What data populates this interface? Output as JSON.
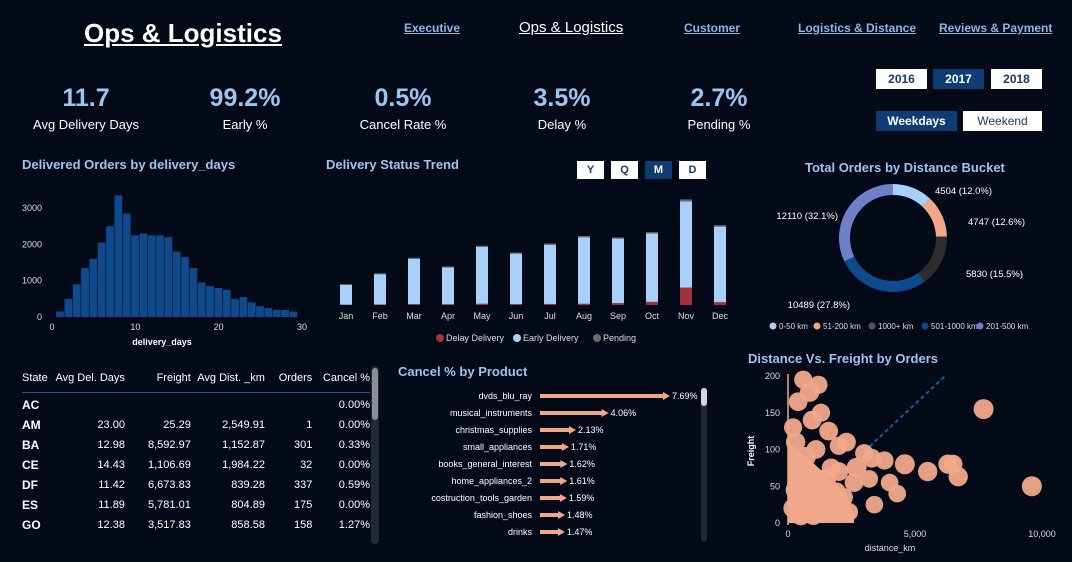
{
  "header": {
    "title": "Ops & Logistics"
  },
  "nav": [
    {
      "label": "Executive",
      "current": false
    },
    {
      "label": "Ops & Logistics",
      "current": true
    },
    {
      "label": "Customer",
      "current": false
    },
    {
      "label": "Logistics & Distance",
      "current": false
    },
    {
      "label": "Reviews & Payment",
      "current": false
    }
  ],
  "kpis": [
    {
      "value": "11.7",
      "label": "Avg Delivery Days"
    },
    {
      "value": "99.2%",
      "label": "Early %"
    },
    {
      "value": "0.5%",
      "label": "Cancel Rate %"
    },
    {
      "value": "3.5%",
      "label": "Delay %"
    },
    {
      "value": "2.7%",
      "label": "Pending %"
    }
  ],
  "filters": {
    "years": [
      {
        "label": "2016",
        "selected": false
      },
      {
        "label": "2017",
        "selected": true
      },
      {
        "label": "2018",
        "selected": false
      }
    ],
    "daytype": [
      {
        "label": "Weekdays",
        "selected": true
      },
      {
        "label": "Weekend",
        "selected": false
      }
    ],
    "granularity": [
      {
        "label": "Y",
        "selected": false
      },
      {
        "label": "Q",
        "selected": false
      },
      {
        "label": "M",
        "selected": true
      },
      {
        "label": "D",
        "selected": false
      }
    ]
  },
  "colors": {
    "bg": "#040a17",
    "accent": "#9ec5f0",
    "bar_dark": "#0f4a8c",
    "early": "#a8d0fb",
    "delay": "#a3303a",
    "pending": "#6b6b6b",
    "salmon": "#f0a88a"
  },
  "chart_data": [
    {
      "id": "histogram",
      "type": "bar",
      "title": "Delivered Orders by delivery_days",
      "xlabel": "delivery_days",
      "ylabel": "",
      "xlim": [
        0,
        30
      ],
      "ylim": [
        0,
        3500
      ],
      "xticks": [
        0,
        10,
        20,
        30
      ],
      "yticks": [
        0,
        1000,
        2000,
        3000
      ],
      "bin_start": 0.5,
      "bin_width": 1,
      "values": [
        150,
        500,
        900,
        1350,
        1600,
        2050,
        2500,
        3350,
        2850,
        2250,
        2300,
        2250,
        2250,
        2200,
        1800,
        1650,
        1350,
        950,
        850,
        800,
        750,
        500,
        550,
        400,
        300,
        250,
        200,
        200,
        150
      ]
    },
    {
      "id": "delivery-trend",
      "type": "bar",
      "title": "Delivery Status Trend",
      "categories": [
        "Jan",
        "Feb",
        "Mar",
        "Apr",
        "May",
        "Jun",
        "Jul",
        "Aug",
        "Sep",
        "Oct",
        "Nov",
        "Dec"
      ],
      "series": [
        {
          "name": "Delay Delivery",
          "values": [
            10,
            15,
            25,
            20,
            35,
            25,
            30,
            35,
            55,
            90,
            500,
            80
          ]
        },
        {
          "name": "Early Delivery",
          "values": [
            570,
            870,
            1300,
            1060,
            1630,
            1450,
            1700,
            1910,
            1850,
            1960,
            2470,
            2170
          ]
        },
        {
          "name": "Pending",
          "values": [
            20,
            25,
            30,
            25,
            35,
            30,
            35,
            35,
            35,
            40,
            60,
            40
          ]
        }
      ],
      "ylim": [
        0,
        3300
      ],
      "legend": "bottom"
    },
    {
      "id": "distance-donut",
      "type": "pie",
      "title": "Total Orders by Distance Bucket",
      "slices": [
        {
          "name": "0-50 km",
          "value": 4504,
          "label": "4504 (12.0%)",
          "color": "#a8d0fb"
        },
        {
          "name": "51-200 km",
          "value": 4747,
          "label": "4747 (12.6%)",
          "color": "#f0a88a"
        },
        {
          "name": "1000+ km",
          "value": 5830,
          "label": "5830 (15.5%)",
          "color": "#2d2d2d"
        },
        {
          "name": "501-1000 km",
          "value": 10489,
          "label": "10489 (27.8%)",
          "color": "#0f4a8c"
        },
        {
          "name": "201-500 km",
          "value": 12110,
          "label": "12110 (32.1%)",
          "color": "#6f7fc9"
        }
      ],
      "legend": "bottom"
    },
    {
      "id": "cancel-by-product",
      "type": "bar",
      "title": "Cancel % by Product",
      "categories": [
        "dvds_blu_ray",
        "musical_instruments",
        "christmas_supplies",
        "small_appliances",
        "books_general_interest",
        "home_appliances_2",
        "costruction_tools_garden",
        "fashion_shoes",
        "drinks"
      ],
      "values": [
        7.69,
        4.06,
        2.13,
        1.71,
        1.62,
        1.61,
        1.59,
        1.48,
        1.47
      ],
      "value_labels": [
        "7.69%",
        "4.06%",
        "2.13%",
        "1.71%",
        "1.62%",
        "1.61%",
        "1.59%",
        "1.48%",
        "1.47%"
      ]
    },
    {
      "id": "distance-freight",
      "type": "scatter",
      "title": "Distance Vs. Freight by Orders",
      "xlabel": "distance_km",
      "ylabel": "Freight",
      "xlim": [
        0,
        10000
      ],
      "ylim": [
        0,
        200
      ],
      "xticks": [
        0,
        5000,
        10000
      ],
      "xtick_labels": [
        "0",
        "5,000",
        "10,000"
      ],
      "yticks": [
        0,
        50,
        100,
        150,
        200
      ],
      "points": [
        [
          9600,
          50,
          1.0
        ],
        [
          7700,
          155,
          1.0
        ],
        [
          6700,
          63,
          0.9
        ],
        [
          6300,
          80,
          0.9
        ],
        [
          6500,
          80,
          0.8
        ],
        [
          5500,
          70,
          0.9
        ],
        [
          4600,
          80,
          1.0
        ],
        [
          3800,
          85,
          0.7
        ],
        [
          3300,
          88,
          0.8
        ],
        [
          3000,
          95,
          0.7
        ],
        [
          2700,
          75,
          1.0
        ],
        [
          2300,
          110,
          0.8
        ],
        [
          2000,
          105,
          0.7
        ],
        [
          1600,
          125,
          0.8
        ],
        [
          1300,
          150,
          0.7
        ],
        [
          850,
          178,
          0.9
        ],
        [
          1200,
          188,
          0.7
        ],
        [
          600,
          195,
          0.7
        ],
        [
          400,
          165,
          0.8
        ],
        [
          950,
          140,
          0.8
        ],
        [
          1900,
          42,
          0.9
        ],
        [
          2200,
          35,
          0.7
        ],
        [
          1500,
          60,
          1.0
        ],
        [
          700,
          90,
          1.0
        ],
        [
          300,
          110,
          0.9
        ],
        [
          500,
          70,
          1.0
        ],
        [
          900,
          40,
          1.0
        ],
        [
          1100,
          100,
          0.8
        ],
        [
          2600,
          55,
          0.8
        ],
        [
          3200,
          60,
          0.6
        ],
        [
          4000,
          55,
          0.6
        ],
        [
          1700,
          75,
          0.8
        ],
        [
          200,
          130,
          0.7
        ],
        [
          600,
          30,
          0.9
        ],
        [
          1300,
          20,
          0.8
        ],
        [
          2400,
          15,
          0.7
        ],
        [
          3400,
          25,
          0.6
        ],
        [
          4300,
          40,
          0.6
        ],
        [
          300,
          45,
          1.0
        ],
        [
          800,
          60,
          1.0
        ],
        [
          1500,
          35,
          0.9
        ],
        [
          200,
          20,
          0.9
        ],
        [
          1000,
          10,
          0.8
        ],
        [
          500,
          10,
          0.9
        ],
        [
          2000,
          70,
          0.8
        ]
      ],
      "reference_line": "dashed diagonal"
    },
    {
      "id": "state-table",
      "type": "table",
      "columns": [
        "State",
        "Avg Del. Days",
        "Freight",
        "Avg Dist. _km",
        "Orders",
        "Cancel %"
      ],
      "rows": [
        [
          "AC",
          "",
          "",
          "",
          "",
          "0.00%"
        ],
        [
          "AM",
          "23.00",
          "25.29",
          "2,549.91",
          "1",
          "0.00%"
        ],
        [
          "BA",
          "12.98",
          "8,592.97",
          "1,152.87",
          "301",
          "0.33%"
        ],
        [
          "CE",
          "14.43",
          "1,106.69",
          "1,984.22",
          "32",
          "0.00%"
        ],
        [
          "DF",
          "11.42",
          "6,673.83",
          "839.28",
          "337",
          "0.59%"
        ],
        [
          "ES",
          "11.89",
          "5,781.01",
          "804.89",
          "175",
          "0.00%"
        ],
        [
          "GO",
          "12.38",
          "3,517.83",
          "858.58",
          "158",
          "1.27%"
        ]
      ]
    }
  ]
}
